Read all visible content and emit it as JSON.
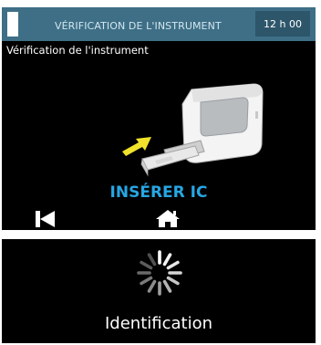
{
  "header": {
    "title": "VÉRIFICATION DE L'INSTRUMENT",
    "time": "12 h 00"
  },
  "main": {
    "subtitle": "Vérification de l'instrument",
    "instruction": "INSÉRER IC"
  },
  "nav": {
    "back_icon": "skip-back-icon",
    "home_icon": "home-icon"
  },
  "status": {
    "label": "Identification",
    "spinner_icon": "loading-spinner-icon"
  },
  "colors": {
    "header": "#3e6f86",
    "time_box": "#2d566a",
    "accent": "#27a6e3",
    "arrow": "#f1e32c",
    "background": "#000000"
  }
}
